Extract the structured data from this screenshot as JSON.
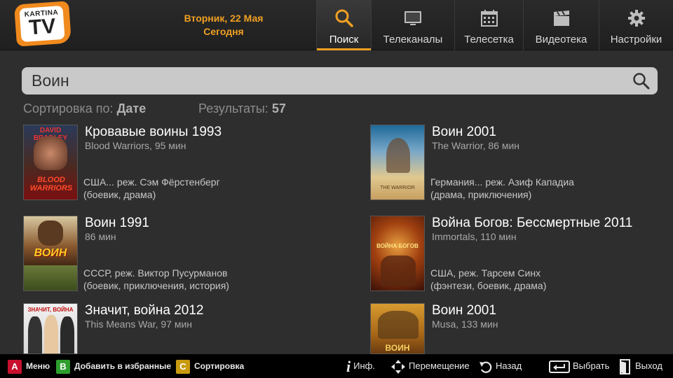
{
  "header": {
    "logo_small": "KARTINA",
    "logo_big": "TV",
    "date_line": "Вторник, 22 Мая",
    "today": "Сегодня",
    "nav": [
      {
        "label": "Поиск",
        "icon": "search-icon",
        "active": true
      },
      {
        "label": "Телеканалы",
        "icon": "tv-icon",
        "active": false
      },
      {
        "label": "Телесетка",
        "icon": "calendar-icon",
        "active": false
      },
      {
        "label": "Видеотека",
        "icon": "clapperboard-icon",
        "active": false
      },
      {
        "label": "Настройки",
        "icon": "gear-icon",
        "active": false
      }
    ]
  },
  "search": {
    "value": "Воин",
    "placeholder": ""
  },
  "sort": {
    "label": "Сортировка по:",
    "value": "Дате"
  },
  "results_count": {
    "label": "Результаты:",
    "value": "57"
  },
  "results": [
    {
      "title": "Кровавые воины",
      "year": "1993",
      "subtitle": "Blood Warriors, 95 мин",
      "meta1": "США... реж. Сэм Фёрстенберг",
      "meta2": "(боевик, драма)",
      "poster_text": "DAVID BRADLEY",
      "poster_title": "BLOOD WARRIORS"
    },
    {
      "title": "Воин",
      "year": "2001",
      "subtitle": "The Warrior,  86 мин",
      "meta1": "Германия... реж. Азиф Кападиа",
      "meta2": "(драма, приключения)",
      "poster_text": "",
      "poster_title": "THE WARRIOR"
    },
    {
      "title": "Воин",
      "year": "1991",
      "subtitle": "86 мин",
      "meta1": "СССР, реж. Виктор Пусурманов",
      "meta2": "(боевик, приключения, история)",
      "poster_text": "",
      "poster_title": "ВОИН"
    },
    {
      "title": "Война Богов: Бессмертные",
      "year": "2011",
      "subtitle": "Immortals, 110 мин",
      "meta1": "США, реж. Тарсем Синх",
      "meta2": "(фэнтези, боевик, драма)",
      "poster_text": "",
      "poster_title": "ВОЙНА БОГОВ"
    },
    {
      "title": "Значит, война",
      "year": "2012",
      "subtitle": "This Means War, 97 мин",
      "meta1": "",
      "meta2": "",
      "poster_text": "",
      "poster_title": "ЗНАЧИТ, ВОЙНА"
    },
    {
      "title": "Воин",
      "year": "2001",
      "subtitle": "Musa, 133 мин",
      "meta1": "",
      "meta2": "",
      "poster_text": "",
      "poster_title": "ВОИН"
    }
  ],
  "footer": {
    "a_key": "A",
    "a_label": "Меню",
    "b_key": "B",
    "b_label": "Добавить в избранные",
    "c_key": "C",
    "c_label": "Сортировка",
    "info_label": "Инф.",
    "move_label": "Перемещение",
    "back_label": "Назад",
    "select_label": "Выбрать",
    "exit_label": "Выход"
  },
  "colors": {
    "accent": "#f0a022",
    "key_a": "#c8102e",
    "key_b": "#2e9e2e",
    "key_c": "#c89a10"
  }
}
